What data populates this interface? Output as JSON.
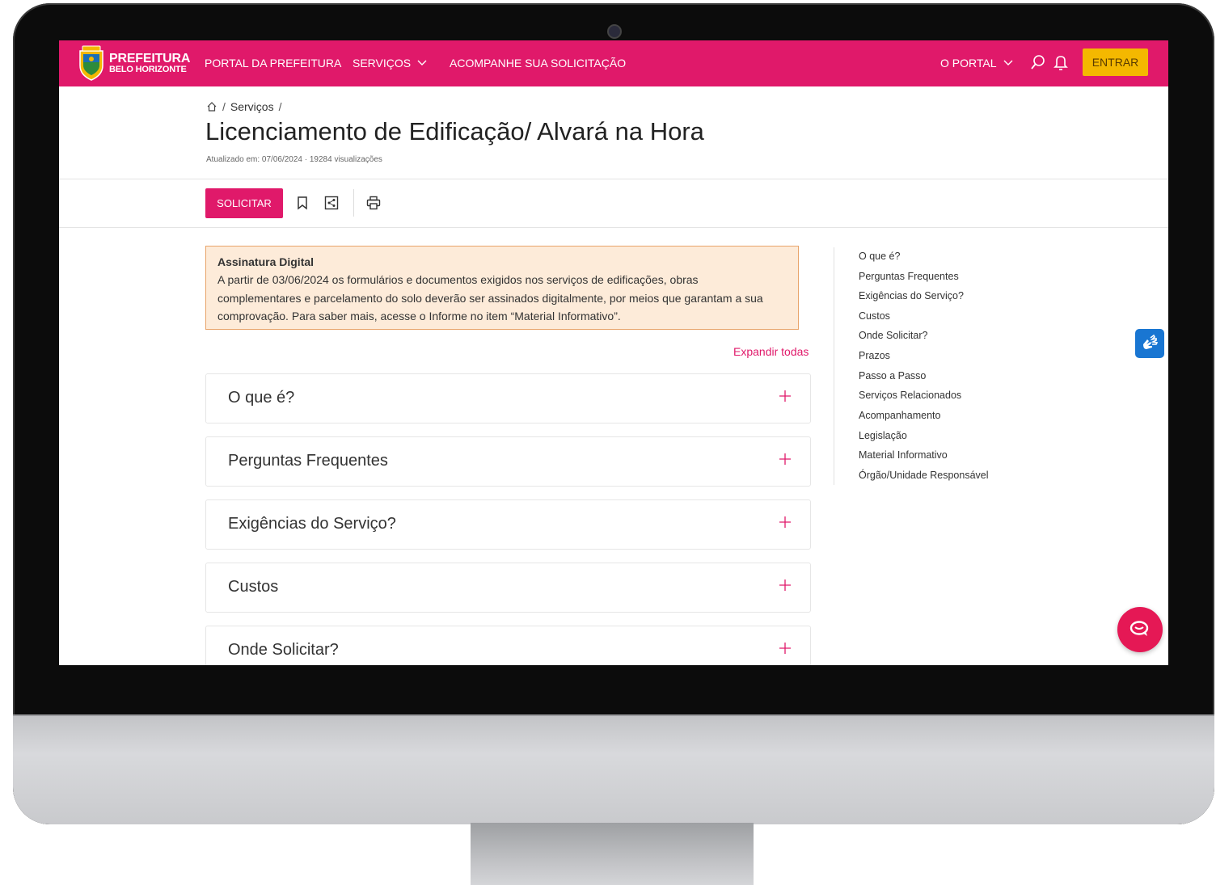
{
  "nav": {
    "logo_line1": "PREFEITURA",
    "logo_line2": "BELO HORIZONTE",
    "links": [
      "PORTAL DA PREFEITURA",
      "SERVIÇOS",
      "ACOMPANHE SUA SOLICITAÇÃO"
    ],
    "portal": "O PORTAL",
    "login": "ENTRAR",
    "brand_color": "#e0196a",
    "login_color": "#f4b800"
  },
  "breadcrumb": {
    "current": "Serviços"
  },
  "page": {
    "title": "Licenciamento de Edificação/ Alvará na Hora",
    "updated": "Atualizado em: 07/06/2024 · 19284 visualizações"
  },
  "toolbar": {
    "request_label": "SOLICITAR"
  },
  "alert": {
    "title": "Assinatura Digital",
    "lines": [
      "A partir de 03/06/2024 os formulários e documentos exigidos nos serviços de edificações, obras",
      "complementares e parcelamento do solo deverão ser assinados digitalmente, por meios que garantam a sua",
      "comprovação. Para saber mais, acesse o Informe no item “Material Informativo”."
    ]
  },
  "expand_all": "Expandir todas",
  "accordion": [
    "O que é?",
    "Perguntas Frequentes",
    "Exigências do Serviço?",
    "Custos",
    "Onde Solicitar?"
  ],
  "sidenav": [
    "O que é?",
    "Perguntas Frequentes",
    "Exigências do Serviço?",
    "Custos",
    "Onde Solicitar?",
    "Prazos",
    "Passo a Passo",
    "Serviços Relacionados",
    "Acompanhamento",
    "Legislação",
    "Material Informativo",
    "Órgão/Unidade Responsável"
  ]
}
